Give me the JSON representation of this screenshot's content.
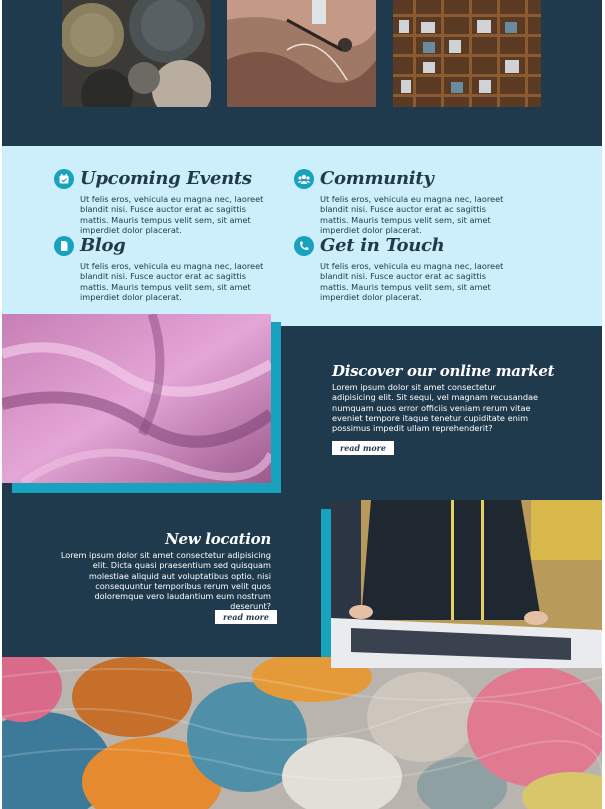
{
  "features": [
    {
      "title": "Upcoming Events",
      "icon": "calendar-icon",
      "text": "Ut felis eros, vehicula eu magna nec, laoreet blandit nisi. Fusce auctor erat ac sagittis mattis. Mauris tempus velit sem, sit amet imperdiet dolor placerat."
    },
    {
      "title": "Community",
      "icon": "users-icon",
      "text": "Ut felis eros, vehicula eu magna nec, laoreet blandit nisi. Fusce auctor erat ac sagittis mattis. Mauris tempus velit sem, sit amet imperdiet dolor placerat."
    },
    {
      "title": "Blog",
      "icon": "document-icon",
      "text": "Ut felis eros, vehicula eu magna nec, laoreet blandit nisi. Fusce auctor erat ac sagittis mattis. Mauris tempus velit sem, sit amet imperdiet dolor placerat."
    },
    {
      "title": "Get in Touch",
      "icon": "phone-icon",
      "text": "Ut felis eros, vehicula eu magna nec, laoreet blandit nisi. Fusce auctor erat ac sagittis mattis. Mauris tempus velit sem, sit amet imperdiet dolor placerat."
    }
  ],
  "market": {
    "title": "Discover our online market",
    "text": "Lorem ipsum dolor sit amet consectetur adipisicing elit. Sit sequi, vel magnam recusandae numquam quos error officiis veniam rerum vitae eveniet tempore itaque tenetur cupiditate enim possimus impedit ullam reprehenderit?",
    "button": "read more"
  },
  "location": {
    "title": "New location",
    "text": "Lorem ipsum dolor sit amet consectetur adipisicing elit. Dicta quasi praesentium sed quisquam molestiae aliquid aut voluptatibus optio, nisi consequuntur temporibus rerum velit quos doloremque vero laudantium eum nostrum deserunt?",
    "button": "read more"
  },
  "colors": {
    "dark": "#1f3a4c",
    "light": "#cdeefb",
    "accent": "#17a2bd"
  }
}
